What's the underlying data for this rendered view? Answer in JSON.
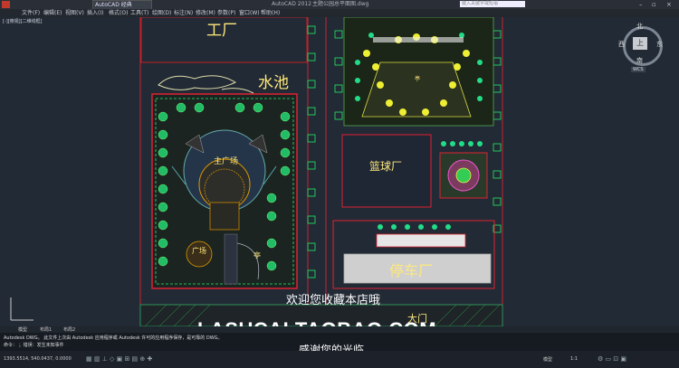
{
  "titlebar": {
    "app": "AutoCAD 经典",
    "center": "AutoCAD 2012",
    "file": "主题公园总平面图.dwg",
    "search_placeholder": "键入关键字或短语"
  },
  "menu": [
    "文件(F)",
    "编辑(E)",
    "视图(V)",
    "插入(I)",
    "格式(O)",
    "工具(T)",
    "绘图(D)",
    "标注(N)",
    "修改(M)",
    "参数(P)",
    "窗口(W)",
    "帮助(H)"
  ],
  "viewport_label": "[-][俯视][二维线框]",
  "viewcube": {
    "north": "北",
    "south": "南",
    "west": "西",
    "east": "东",
    "center": "上",
    "wcs": "WCS"
  },
  "labels": {
    "factory": "工厂",
    "pond": "水池",
    "main_plaza": "主广场",
    "plaza": "广场",
    "pavilion1": "亭",
    "pavilion2": "亭",
    "basketball": "篮球厂",
    "parking": "停车厂",
    "bottom": "大门"
  },
  "overlay": {
    "line1": "欢迎您收藏本店哦",
    "line2": "LASUCAI.TAOBAO.COM",
    "line3": "感谢您的光临"
  },
  "tabs": [
    "模型",
    "布局1",
    "布局2"
  ],
  "command_lines": [
    "Autodesk DWG。 此文件上次由 Autodesk 应用程序或 Autodesk 许可的应用程序保存，是可靠的 DWG。",
    "命令：  ；错误：发生未知事件"
  ],
  "status": {
    "coords": "1393.5514, 540.0437, 0.0000",
    "model": "模型",
    "scale": "1:1"
  }
}
